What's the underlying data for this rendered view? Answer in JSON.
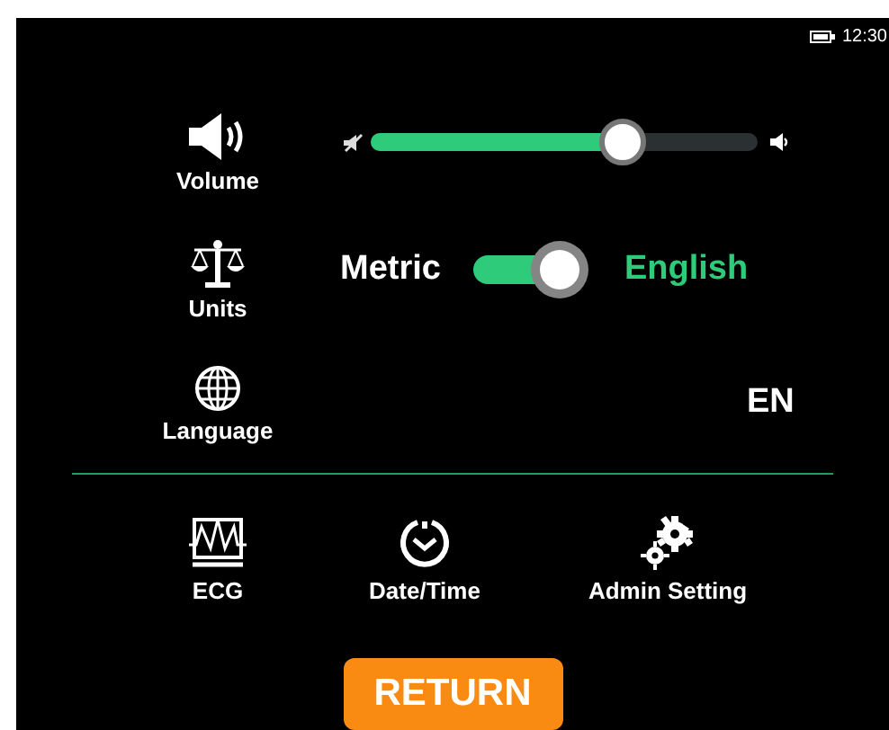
{
  "status_bar": {
    "time": "12:30"
  },
  "volume": {
    "label": "Volume",
    "level": 0.65
  },
  "units": {
    "label": "Units",
    "left_label": "Metric",
    "right_label": "English",
    "on": true
  },
  "language": {
    "label": "Language",
    "value": "EN"
  },
  "shortcuts": [
    {
      "kind": "ecg",
      "label": "ECG"
    },
    {
      "kind": "clock",
      "label": "Date/Time"
    },
    {
      "kind": "gears",
      "label": "Admin Setting"
    }
  ],
  "return_button": {
    "label": "RETURN"
  }
}
